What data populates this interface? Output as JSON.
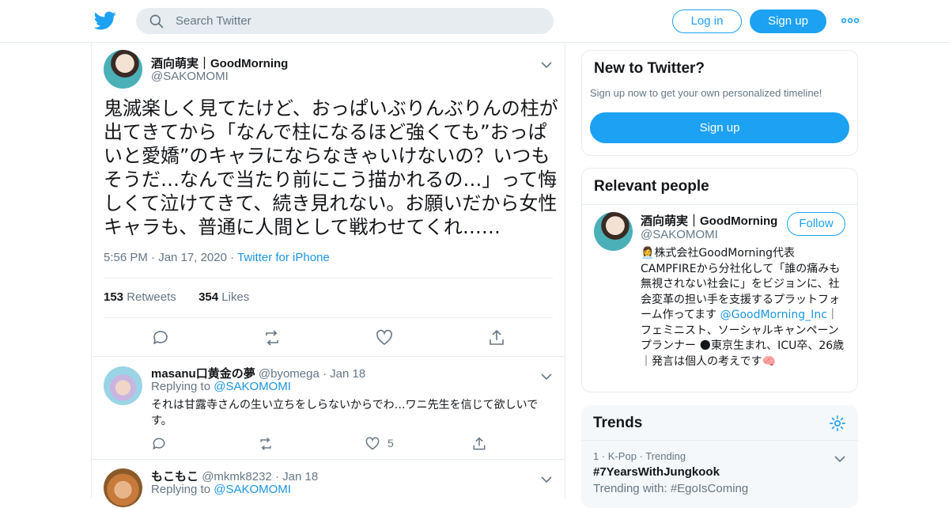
{
  "search": {
    "placeholder": "Search Twitter"
  },
  "header": {
    "login_label": "Log in",
    "signup_label": "Sign up",
    "more_icon": "more-icon"
  },
  "tweet": {
    "author_name": "酒向萌実｜GoodMorning",
    "author_handle": "@SAKOMOMI",
    "text": "鬼滅楽しく見てたけど、おっぱいぶりんぶりんの柱が出てきてから「なんで柱になるほど強くても”おっぱいと愛嬌”のキャラにならなきゃいけないの？いつもそうだ…なんで当たり前にこう描かれるの…」って悔しくて泣けてきて、続き見れない。お願いだから女性キャラも、普通に人間として戦わせてくれ……",
    "time": "5:56 PM",
    "date": "Jan 17, 2020",
    "source": "Twitter for iPhone",
    "retweets_count": "153",
    "retweets_label": "Retweets",
    "likes_count": "354",
    "likes_label": "Likes"
  },
  "replies": [
    {
      "name": "masanu⼝黄金の夢",
      "handle": "@byomega",
      "date": "Jan 18",
      "replying_label": "Replying to",
      "replying_to": "@SAKOMOMI",
      "text": "それは甘露寺さんの生い立ちをしらないからでわ…ワニ先生を信じて欲しいです。",
      "likes": "5"
    },
    {
      "name": "もこもこ",
      "handle": "@mkmk8232",
      "date": "Jan 18",
      "replying_label": "Replying to",
      "replying_to": "@SAKOMOMI"
    }
  ],
  "new_to_twitter": {
    "title": "New to Twitter?",
    "subtitle": "Sign up now to get your own personalized timeline!",
    "signup_label": "Sign up"
  },
  "relevant": {
    "title": "Relevant people",
    "name": "酒向萌実｜GoodMorning",
    "handle": "@SAKOMOMI",
    "follow_label": "Follow",
    "bio_1": "👩‍💼株式会社GoodMorning代表 CAMPFIREから分社化して「誰の痛みも無視されない社会に」をビジョンに、社会変革の担い手を支援するプラットフォーム作ってます ",
    "bio_link": "@GoodMorning_Inc",
    "bio_2": "｜フェミニスト、ソーシャルキャンペーンプランナー 🌑東京生まれ、ICU卒、26歳｜発言は個人の考えです🧠"
  },
  "trends": {
    "title": "Trends",
    "items": [
      {
        "rank": "1",
        "category": "K-Pop",
        "status": "Trending",
        "name": "#7YearsWithJungkook",
        "with_label": "Trending with:",
        "with_tag": "#EgoIsComing"
      }
    ]
  },
  "colors": {
    "accent": "#1da1f2",
    "link": "#1b95e0",
    "muted": "#657786",
    "border": "#e6ecf0"
  }
}
